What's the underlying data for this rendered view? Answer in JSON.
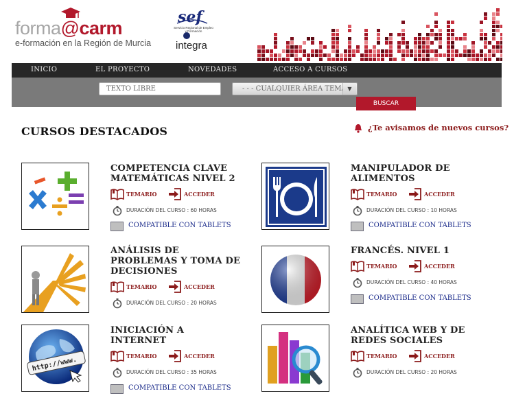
{
  "header": {
    "logo_part1": "forma",
    "logo_at": "@",
    "logo_part2": "carm",
    "tagline": "e-formación en la Región de Murcia",
    "sef_text": "Servicio Regional de Empleo y Formación",
    "integra_label": "integra"
  },
  "nav": {
    "items": [
      {
        "label": "INICIO"
      },
      {
        "label": "EL PROYECTO"
      },
      {
        "label": "NOVEDADES"
      },
      {
        "label": "ACCESO A CURSOS"
      }
    ]
  },
  "search": {
    "placeholder": "TEXTO LIBRE",
    "area_selected": "- - - CUALQUIER ÁREA TEMÁ",
    "button_label": "BUSCAR"
  },
  "main": {
    "section_title": "CURSOS DESTACADOS",
    "notify_label": "¿Te avisamos de nuevos cursos?",
    "temario_label": "TEMARIO",
    "acceder_label": "ACCEDER",
    "tablets_label": "COMPATIBLE CON TABLETS",
    "courses": [
      {
        "title_lines": [
          "COMPETENCIA CLAVE",
          "MATEMÁTICAS NIVEL 2",
          ""
        ],
        "duration": "DURACIÓN DEL CURSO : 60 HORAS",
        "tablets": true,
        "image": "math-symbols-icon"
      },
      {
        "title_lines": [
          "MANIPULADOR DE",
          "ALIMENTOS",
          ""
        ],
        "duration": "DURACIÓN DEL CURSO : 10 HORAS",
        "tablets": true,
        "image": "plate-cutlery-icon"
      },
      {
        "title_lines": [
          "ANÁLISIS DE",
          "PROBLEMAS Y TOMA DE",
          "DECISIONES"
        ],
        "duration": "DURACIÓN DEL CURSO : 20 HORAS",
        "tablets": false,
        "image": "crossroads-figure-icon"
      },
      {
        "title_lines": [
          "FRANCÉS. NIVEL 1",
          "",
          ""
        ],
        "duration": "DURACIÓN DEL CURSO : 40 HORAS",
        "tablets": true,
        "image": "french-flag-sphere-icon"
      },
      {
        "title_lines": [
          "INICIACIÓN A",
          "INTERNET",
          ""
        ],
        "duration": "DURACIÓN DEL CURSO : 35 HORAS",
        "tablets": true,
        "image": "globe-www-icon"
      },
      {
        "title_lines": [
          "ANALÍTICA WEB Y DE",
          "REDES SOCIALES",
          ""
        ],
        "duration": "DURACIÓN DEL CURSO : 20 HORAS",
        "tablets": false,
        "image": "bar-chart-magnifier-icon"
      }
    ]
  },
  "colors": {
    "brand_red": "#b2182b",
    "link_red": "#8b1a1a",
    "nav_dark": "#272727",
    "search_gray": "#7a7a7a",
    "tablet_blue": "#1a2a8a"
  }
}
